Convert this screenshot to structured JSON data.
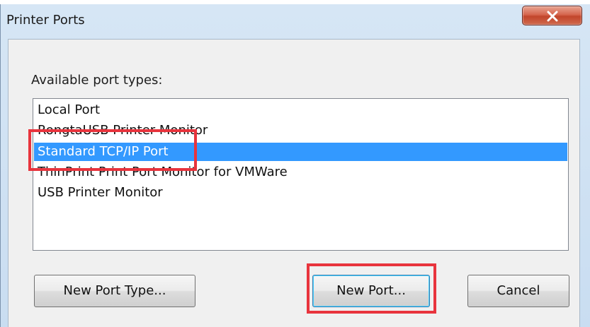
{
  "window": {
    "title": "Printer Ports",
    "close_label": "close"
  },
  "dialog": {
    "label": "Available port types:",
    "items": [
      {
        "label": "Local Port",
        "selected": false
      },
      {
        "label": "RongtaUSB Printer Monitor",
        "selected": false
      },
      {
        "label": "Standard TCP/IP Port",
        "selected": true
      },
      {
        "label": "ThinPrint Print Port Monitor for VMWare",
        "selected": false
      },
      {
        "label": "USB Printer Monitor",
        "selected": false
      }
    ],
    "buttons": {
      "new_port_type": "New Port Type...",
      "new_port": "New Port...",
      "cancel": "Cancel"
    }
  },
  "colors": {
    "selection": "#3399ff",
    "annotation": "#e8343d",
    "close_button": "#c2452b"
  },
  "annotations": [
    "selected-port-highlight",
    "new-port-highlight"
  ]
}
